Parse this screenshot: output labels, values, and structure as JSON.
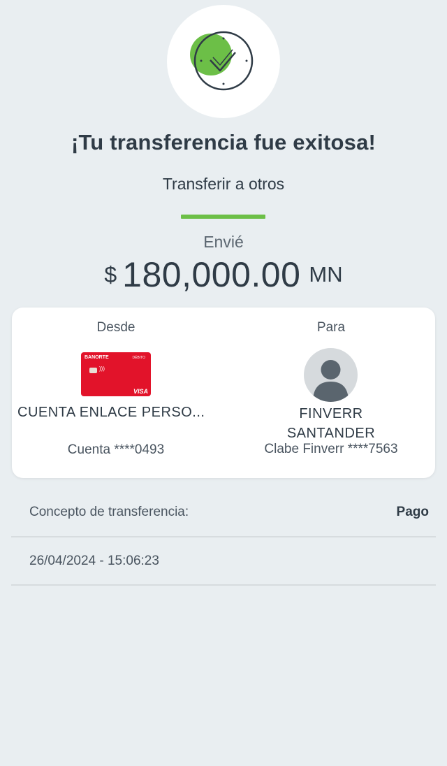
{
  "status": {
    "icon": "success-check-icon",
    "title": "¡Tu transferencia fue exitosa!",
    "subtitle": "Transferir a otros"
  },
  "amount": {
    "label": "Envié",
    "currency_symbol": "$",
    "value": "180,000.00",
    "unit": "MN"
  },
  "transfer": {
    "from": {
      "label": "Desde",
      "card_brand": "BANORTE",
      "card_type": "DÉBITO",
      "card_network": "VISA",
      "name": "CUENTA ENLACE PERSO...",
      "account": "Cuenta ****0493"
    },
    "to": {
      "label": "Para",
      "name_line1": "FINVERR",
      "name_line2": "SANTANDER",
      "account": "Clabe Finverr ****7563"
    }
  },
  "details": {
    "concept_label": "Concepto de transferencia:",
    "concept_value": "Pago",
    "datetime": "26/04/2024 - 15:06:23"
  },
  "colors": {
    "background": "#e9eef1",
    "accent_green": "#6cbf47",
    "card_red": "#e2132a",
    "text_dark": "#2f3b46"
  }
}
